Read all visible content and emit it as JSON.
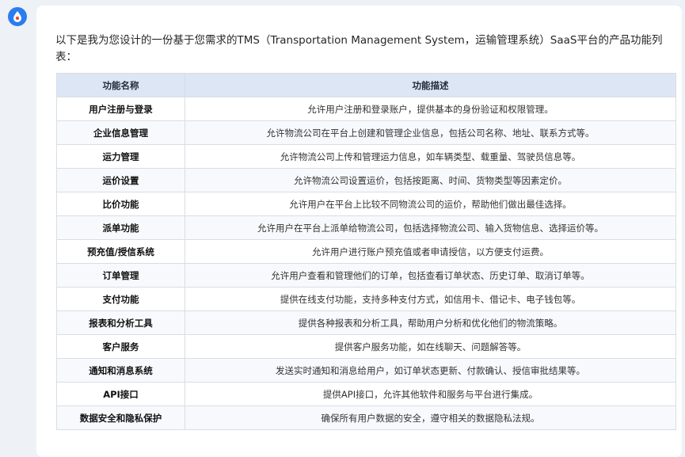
{
  "assistant": {
    "avatar_icon": "logo-drop-icon"
  },
  "message": {
    "intro": "以下是我为您设计的一份基于您需求的TMS（Transportation Management System，运输管理系统）SaaS平台的产品功能列表：",
    "table": {
      "headers": [
        "功能名称",
        "功能描述"
      ],
      "rows": [
        {
          "name": "用户注册与登录",
          "desc": "允许用户注册和登录账户，提供基本的身份验证和权限管理。"
        },
        {
          "name": "企业信息管理",
          "desc": "允许物流公司在平台上创建和管理企业信息，包括公司名称、地址、联系方式等。"
        },
        {
          "name": "运力管理",
          "desc": "允许物流公司上传和管理运力信息，如车辆类型、载重量、驾驶员信息等。"
        },
        {
          "name": "运价设置",
          "desc": "允许物流公司设置运价，包括按距离、时间、货物类型等因素定价。"
        },
        {
          "name": "比价功能",
          "desc": "允许用户在平台上比较不同物流公司的运价，帮助他们做出最佳选择。"
        },
        {
          "name": "派单功能",
          "desc": "允许用户在平台上派单给物流公司，包括选择物流公司、输入货物信息、选择运价等。"
        },
        {
          "name": "预充值/授信系统",
          "desc": "允许用户进行账户预充值或者申请授信，以方便支付运费。"
        },
        {
          "name": "订单管理",
          "desc": "允许用户查看和管理他们的订单，包括查看订单状态、历史订单、取消订单等。"
        },
        {
          "name": "支付功能",
          "desc": "提供在线支付功能，支持多种支付方式，如信用卡、借记卡、电子钱包等。"
        },
        {
          "name": "报表和分析工具",
          "desc": "提供各种报表和分析工具，帮助用户分析和优化他们的物流策略。"
        },
        {
          "name": "客户服务",
          "desc": "提供客户服务功能，如在线聊天、问题解答等。"
        },
        {
          "name": "通知和消息系统",
          "desc": "发送实时通知和消息给用户，如订单状态更新、付款确认、授信审批结果等。"
        },
        {
          "name": "API接口",
          "desc": "提供API接口，允许其他软件和服务与平台进行集成。"
        },
        {
          "name": "数据安全和隐私保护",
          "desc": "确保所有用户数据的安全，遵守相关的数据隐私法规。"
        }
      ]
    }
  }
}
